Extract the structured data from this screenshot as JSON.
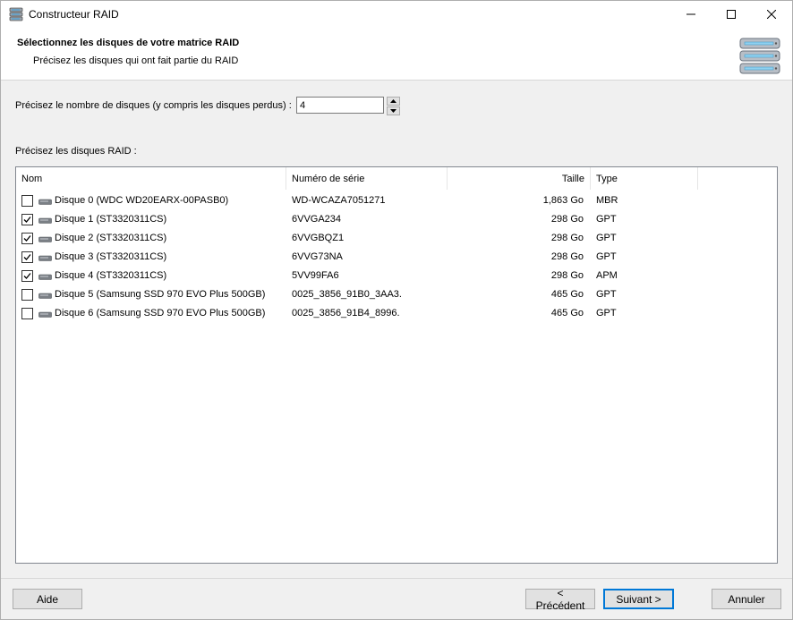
{
  "window": {
    "title": "Constructeur RAID"
  },
  "header": {
    "title": "Sélectionnez les disques de votre matrice RAID",
    "subtitle": "Précisez les disques qui ont fait partie du RAID"
  },
  "disk_count": {
    "label": "Précisez le nombre de disques (y compris les disques perdus) :",
    "value": "4"
  },
  "disks_label": "Précisez les disques RAID :",
  "table": {
    "columns": [
      "Nom",
      "Numéro de série",
      "Taille",
      "Type"
    ],
    "rows": [
      {
        "checked": false,
        "name": "Disque 0 (WDC WD20EARX-00PASB0)",
        "serial": "WD-WCAZA7051271",
        "size": "1,863 Go",
        "type": "MBR"
      },
      {
        "checked": true,
        "name": "Disque 1 (ST3320311CS)",
        "serial": "6VVGA234",
        "size": "298 Go",
        "type": "GPT"
      },
      {
        "checked": true,
        "name": "Disque 2 (ST3320311CS)",
        "serial": "6VVGBQZ1",
        "size": "298 Go",
        "type": "GPT"
      },
      {
        "checked": true,
        "name": "Disque 3 (ST3320311CS)",
        "serial": "6VVG73NA",
        "size": "298 Go",
        "type": "GPT"
      },
      {
        "checked": true,
        "name": "Disque 4 (ST3320311CS)",
        "serial": "5VV99FA6",
        "size": "298 Go",
        "type": "APM"
      },
      {
        "checked": false,
        "name": "Disque 5 (Samsung SSD 970 EVO Plus 500GB)",
        "serial": "0025_3856_91B0_3AA3.",
        "size": "465 Go",
        "type": "GPT"
      },
      {
        "checked": false,
        "name": "Disque 6 (Samsung SSD 970 EVO Plus 500GB)",
        "serial": "0025_3856_91B4_8996.",
        "size": "465 Go",
        "type": "GPT"
      }
    ]
  },
  "buttons": {
    "help": "Aide",
    "previous": "< Précédent",
    "next": "Suivant >",
    "cancel": "Annuler"
  },
  "colors": {
    "accent": "#0078d7",
    "disk_icon": "#7a7f85",
    "raid_icon": "#8fd1f0"
  }
}
